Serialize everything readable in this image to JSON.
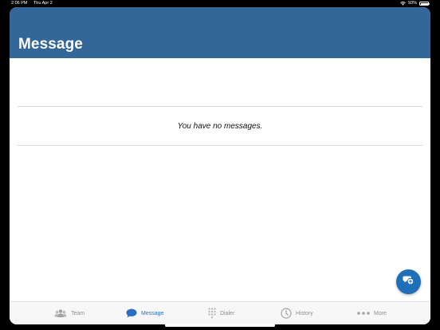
{
  "status_bar": {
    "time": "2:06 PM",
    "date": "Thu Apr 2",
    "battery": "93%",
    "battery_level": 0.93
  },
  "header": {
    "title": "Message",
    "background_color": "#336699"
  },
  "main": {
    "empty_message": "You have no messages."
  },
  "fab": {
    "icon": "new-chat-icon",
    "color": "#1f6fb8"
  },
  "tabbar": {
    "active_color": "#2a6fc1",
    "inactive_color": "#8e8e93",
    "tabs": [
      {
        "label": "Team",
        "icon": "team-icon",
        "active": false
      },
      {
        "label": "Message",
        "icon": "message-bubble-icon",
        "active": true
      },
      {
        "label": "Dialer",
        "icon": "dialpad-icon",
        "active": false
      },
      {
        "label": "History",
        "icon": "clock-icon",
        "active": false
      },
      {
        "label": "More",
        "icon": "more-dots-icon",
        "active": false
      }
    ]
  }
}
